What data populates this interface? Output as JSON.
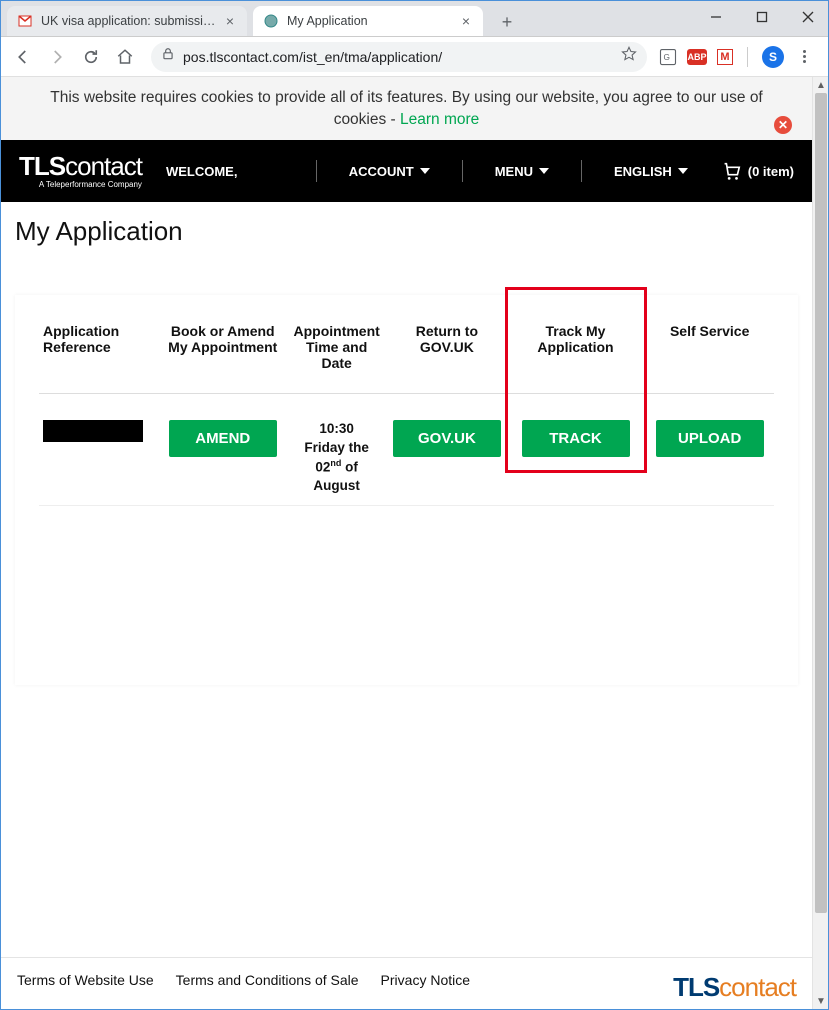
{
  "browser": {
    "tabs": [
      {
        "title": "UK visa application: submission c",
        "active": false
      },
      {
        "title": "My Application",
        "active": true
      }
    ],
    "url": "pos.tlscontact.com/ist_en/tma/application/",
    "avatar_letter": "S",
    "abp_label": "ABP"
  },
  "cookie": {
    "text": "This website requires cookies to provide all of its features. By using our website, you agree to our use of cookies - ",
    "link": "Learn more"
  },
  "header": {
    "logo_bold": "TLS",
    "logo_rest": "contact",
    "logo_sub": "A Teleperformance Company",
    "welcome": "WELCOME,",
    "account": "ACCOUNT",
    "menu": "MENU",
    "language": "ENGLISH",
    "cart": "(0 item)"
  },
  "page": {
    "title": "My Application"
  },
  "table": {
    "headers": {
      "ref": "Application Reference",
      "book": "Book or Amend My Appointment",
      "appt": "Appointment Time and Date",
      "return": "Return to GOV.UK",
      "track": "Track My Application",
      "self": "Self Service"
    },
    "row": {
      "amend_btn": "AMEND",
      "appt_time": "10:30",
      "appt_day": "Friday the",
      "appt_date_pre": "02",
      "appt_date_sup": "nd",
      "appt_date_post": " of",
      "appt_month": "August",
      "govuk_btn": "GOV.UK",
      "track_btn": "TRACK",
      "upload_btn": "UPLOAD"
    }
  },
  "footer": {
    "links": [
      "Terms of Website Use",
      "Terms and Conditions of Sale",
      "Privacy Notice"
    ],
    "logo_bold": "TLS",
    "logo_rest": "contact"
  }
}
